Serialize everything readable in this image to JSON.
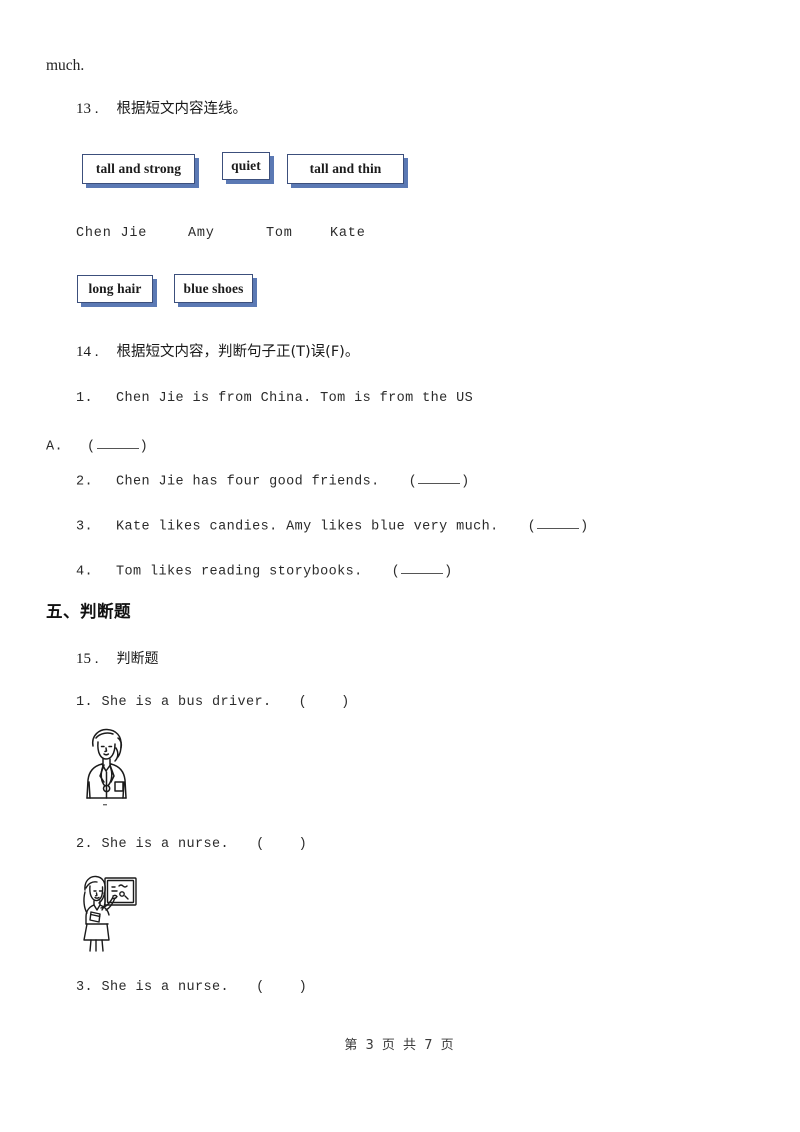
{
  "document": {
    "type": "english-worksheet-page",
    "continuation_text": "much."
  },
  "question_13": {
    "number": "13 .",
    "prompt": "根据短文内容连线。",
    "top_boxes": [
      {
        "label": "tall and strong"
      },
      {
        "label": "quiet"
      },
      {
        "label": "tall and thin"
      }
    ],
    "names": [
      {
        "label": "Chen Jie"
      },
      {
        "label": "Amy"
      },
      {
        "label": "Tom"
      },
      {
        "label": "Kate"
      }
    ],
    "bottom_boxes": [
      {
        "label": "long hair"
      },
      {
        "label": "blue shoes"
      }
    ]
  },
  "question_14": {
    "number": "14 .",
    "prompt": "根据短文内容，判断句子正(T)误(F)。",
    "items": [
      {
        "marker": "1.",
        "text": "Chen Jie is from China. Tom is from the US"
      },
      {
        "marker": "A.",
        "text": "",
        "blank": true
      },
      {
        "marker": "2.",
        "text": "Chen Jie has four good friends.",
        "blank": true
      },
      {
        "marker": "3.",
        "text": "Kate likes candies. Amy likes blue very much.",
        "blank": true
      },
      {
        "marker": "4.",
        "text": "Tom likes reading storybooks.",
        "blank": true
      }
    ]
  },
  "section_five": {
    "heading": "五、判断题"
  },
  "question_15": {
    "number": "15 .",
    "prompt": "判断题",
    "items": [
      {
        "marker": "1.",
        "text": "She is a bus driver.",
        "figure": "doctor-woman-illustration"
      },
      {
        "marker": "2.",
        "text": "She is a nurse.",
        "figure": "teacher-at-board-illustration"
      },
      {
        "marker": "3.",
        "text": "She is a nurse.",
        "figure": null
      }
    ]
  },
  "footer": {
    "page_text": "第 3 页 共 7 页",
    "current_page": "3",
    "total_pages": "7"
  },
  "colors": {
    "box_border": "#3c4f7c",
    "box_shadow": "#5b79b4",
    "text": "#222222",
    "page_background": "#ffffff"
  }
}
